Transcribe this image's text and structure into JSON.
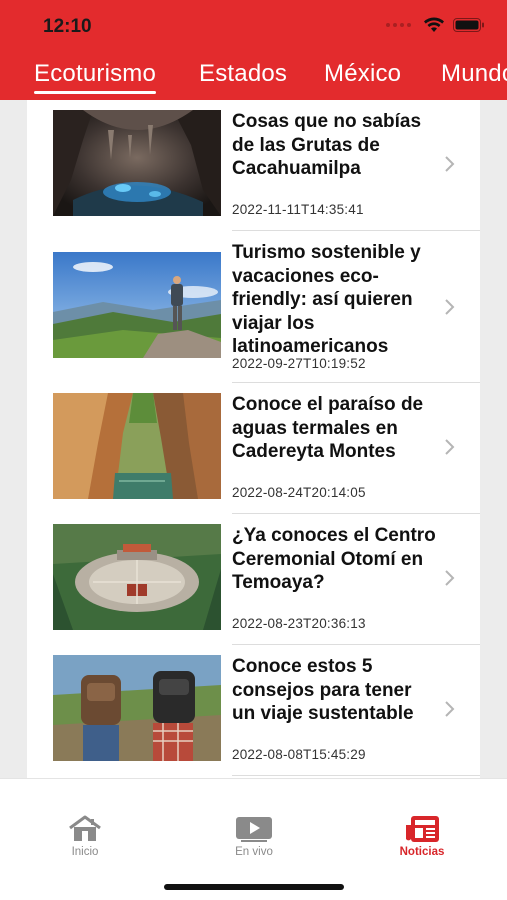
{
  "status_bar": {
    "time": "12:10"
  },
  "top_tabs": [
    {
      "label": "Ecoturismo",
      "active": true
    },
    {
      "label": "Estados",
      "active": false
    },
    {
      "label": "México",
      "active": false
    },
    {
      "label": "Mundo",
      "active": false
    }
  ],
  "articles": [
    {
      "title": "Cosas que no sabías de las Grutas de Cacahuamilpa",
      "date": "2022-11-11T14:35:41",
      "image": "cave-photo"
    },
    {
      "title": "Turismo sostenible y vacaciones eco-friendly: así quieren viajar los latinoamericanos",
      "date": "2022-09-27T10:19:52",
      "image": "hiker-mountain-photo"
    },
    {
      "title": "Conoce el paraíso de aguas termales en Cadereyta Montes",
      "date": "2022-08-24T20:14:05",
      "image": "canyon-river-photo"
    },
    {
      "title": "¿Ya conoces el Centro Ceremonial Otomí en Temoaya?",
      "date": "2022-08-23T20:36:13",
      "image": "ceremonial-center-photo"
    },
    {
      "title": "Conoce estos 5 consejos para tener un viaje sustentable",
      "date": "2022-08-08T15:45:29",
      "image": "backpackers-photo"
    }
  ],
  "bottom_nav": [
    {
      "label": "Inicio",
      "icon": "home-icon",
      "active": false
    },
    {
      "label": "En vivo",
      "icon": "play-icon",
      "active": false
    },
    {
      "label": "Noticias",
      "icon": "newspaper-icon",
      "active": true
    }
  ],
  "colors": {
    "brand_red": "#e32b2d",
    "active_nav": "#d8262a"
  }
}
